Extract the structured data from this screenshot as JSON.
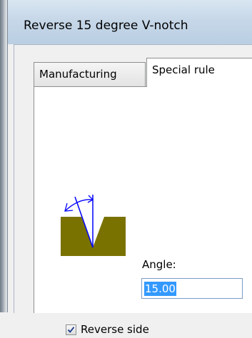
{
  "window": {
    "title": "Reverse 15 degree V-notch"
  },
  "tabs": [
    {
      "label": "Manufacturing",
      "selected": false
    },
    {
      "label": "Special rule",
      "selected": true
    }
  ],
  "special_rule": {
    "illustration_icon": "v-notch-angle-diagram",
    "angle": {
      "label": "Angle:",
      "value": "15.00",
      "selected_text": true
    },
    "reverse_side": {
      "label": "Reverse side",
      "checked": true
    }
  },
  "colors": {
    "title_bar": "#c6d7e8",
    "tab_panel": "#ffffff",
    "notch_fill": "#7a7200",
    "diagram_lines": "#0000ff",
    "selection": "#3399ff"
  }
}
